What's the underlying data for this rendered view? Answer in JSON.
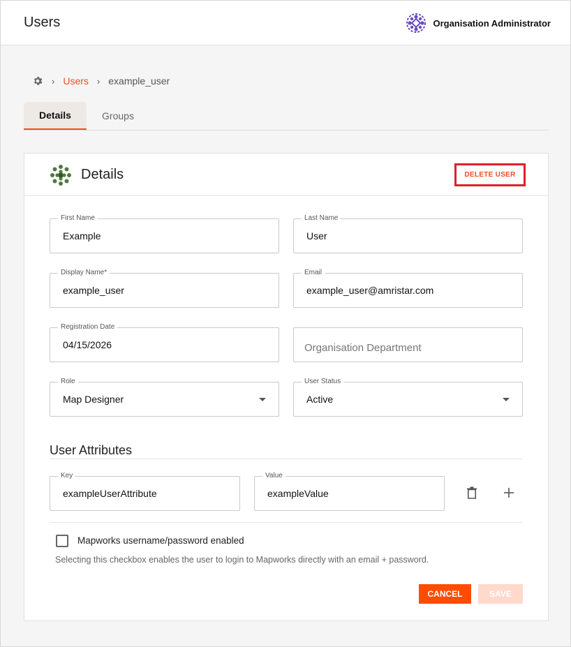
{
  "header": {
    "title": "Users",
    "org_label": "Organisation Administrator"
  },
  "breadcrumb": {
    "sep": "›",
    "users": "Users",
    "current": "example_user"
  },
  "tabs": [
    {
      "label": "Details",
      "active": true
    },
    {
      "label": "Groups",
      "active": false
    }
  ],
  "card": {
    "title": "Details",
    "delete_label": "DELETE USER"
  },
  "form": {
    "first_name": {
      "label": "First Name",
      "value": "Example"
    },
    "last_name": {
      "label": "Last Name",
      "value": "User"
    },
    "display_name": {
      "label": "Display Name*",
      "value": "example_user"
    },
    "email": {
      "label": "Email",
      "value": "example_user@amristar.com"
    },
    "registration_date": {
      "label": "Registration Date",
      "value": "04/15/2026"
    },
    "department": {
      "placeholder": "Organisation Department"
    },
    "role": {
      "label": "Role",
      "value": "Map Designer"
    },
    "user_status": {
      "label": "User Status",
      "value": "Active"
    }
  },
  "attributes": {
    "title": "User Attributes",
    "key": {
      "label": "Key",
      "value": "exampleUserAttribute"
    },
    "value": {
      "label": "Value",
      "value": "exampleValue"
    }
  },
  "mapworks": {
    "checkbox_label": "Mapworks username/password enabled",
    "checked": false,
    "helper": "Selecting this checkbox enables the user to login to Mapworks directly with an email + password."
  },
  "actions": {
    "cancel": "CANCEL",
    "save": "SAVE"
  },
  "colors": {
    "accent": "#f04e1a",
    "delete_outline": "#e0202a",
    "cancel_bg": "#ff4d00",
    "save_disabled_bg": "#ffd9cc"
  },
  "icons": {
    "org_logo": "org-logo-icon",
    "settings": "gear-icon",
    "card_logo": "card-logo-icon",
    "delete": "trash-icon",
    "add": "plus-icon",
    "dropdown": "caret-down-icon"
  }
}
